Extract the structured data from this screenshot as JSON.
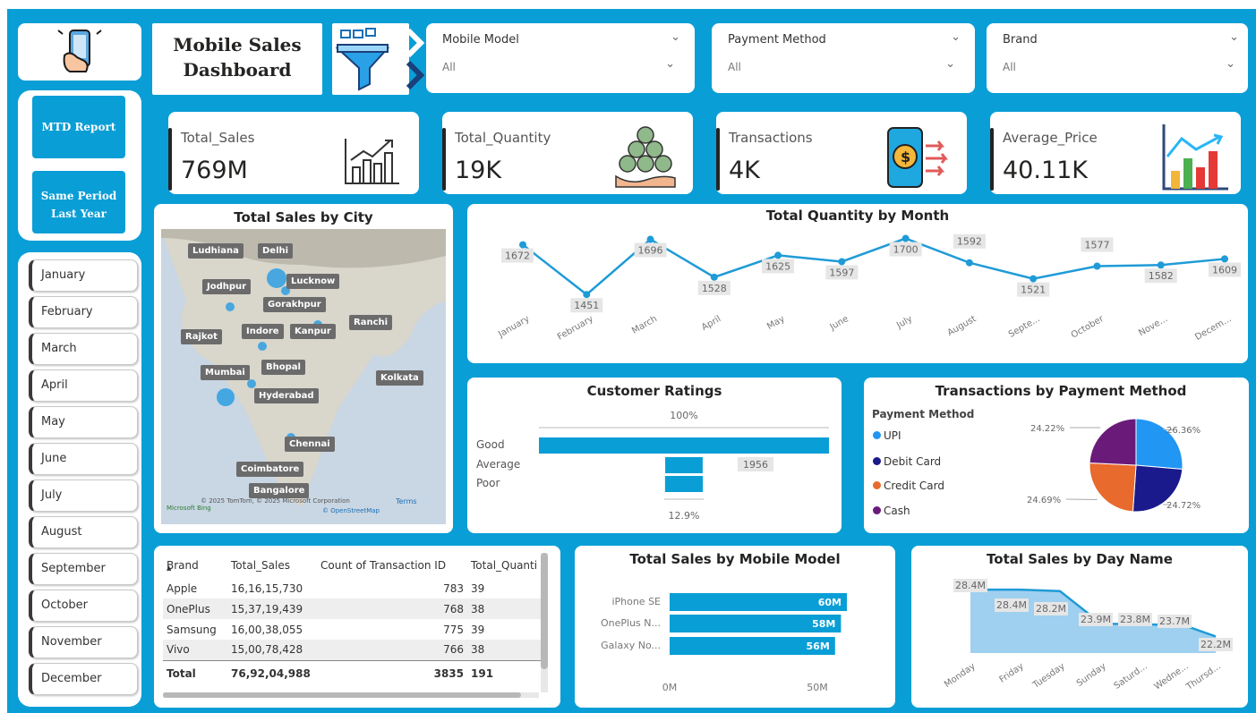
{
  "header": {
    "title_line1": "Mobile Sales",
    "title_line2": "Dashboard"
  },
  "filters": [
    {
      "label": "Mobile Model",
      "value": "All"
    },
    {
      "label": "Payment Method",
      "value": "All"
    },
    {
      "label": "Brand",
      "value": "All"
    }
  ],
  "nav": {
    "mtd_button": "MTD Report",
    "same_period_line1": "Same Period",
    "same_period_line2": "Last Year"
  },
  "months": [
    "January",
    "February",
    "March",
    "April",
    "May",
    "June",
    "July",
    "August",
    "September",
    "October",
    "November",
    "December"
  ],
  "kpis": [
    {
      "label": "Total_Sales",
      "value": "769M",
      "icon": "bar-chart-growth-icon"
    },
    {
      "label": "Total_Quantity",
      "value": "19K",
      "icon": "money-bags-icon"
    },
    {
      "label": "Transactions",
      "value": "4K",
      "icon": "mobile-payment-icon"
    },
    {
      "label": "Average_Price",
      "value": "40.11K",
      "icon": "colored-bar-chart-icon"
    }
  ],
  "map": {
    "title": "Total Sales by City",
    "cities": [
      "Ludhiana",
      "Delhi",
      "Jodhpur",
      "Lucknow",
      "Gorakhpur",
      "Ranchi",
      "Indore",
      "Kanpur",
      "Rajkot",
      "Bhopal",
      "Mumbai",
      "Kolkata",
      "Hyderabad",
      "Chennai",
      "Coimbatore",
      "Bangalore"
    ],
    "copyright": "© 2025 TomTom, © 2025 Microsoft Corporation",
    "terms": "Terms",
    "osm": "© OpenStreetMap",
    "provider": "Microsoft Bing"
  },
  "chart_data": [
    {
      "type": "line",
      "title": "Total Quantity by Month",
      "categories": [
        "January",
        "February",
        "March",
        "April",
        "May",
        "June",
        "July",
        "August",
        "Septe...",
        "October",
        "Nove...",
        "Decem..."
      ],
      "values": [
        1672,
        1451,
        1696,
        1528,
        1625,
        1597,
        1700,
        1592,
        1521,
        1577,
        1582,
        1609
      ],
      "color": "#1f9bd7"
    },
    {
      "type": "bar",
      "title": "Customer Ratings",
      "categories": [
        "Good",
        "Average",
        "Poor"
      ],
      "values": [
        15145,
        1956,
        1976
      ],
      "labels": [
        "100%",
        "1956",
        "12.9%"
      ],
      "color": "#0a9ed6"
    },
    {
      "type": "pie",
      "title": "Transactions by Payment Method",
      "legend_title": "Payment Method",
      "categories": [
        "UPI",
        "Debit Card",
        "Credit Card",
        "Cash"
      ],
      "values": [
        26.36,
        24.72,
        24.69,
        24.22
      ],
      "labels": [
        "26.36%",
        "24.72%",
        "24.69%",
        "24.22%"
      ],
      "colors": [
        "#2196f3",
        "#1a1a8c",
        "#e86a2c",
        "#6a1b7a"
      ]
    },
    {
      "type": "table",
      "columns": [
        "Brand",
        "Total_Sales",
        "Count of Transaction ID",
        "Total_Quanti"
      ],
      "rows": [
        [
          "Apple",
          "16,16,15,730",
          "783",
          "39"
        ],
        [
          "OnePlus",
          "15,37,19,439",
          "768",
          "38"
        ],
        [
          "Samsung",
          "16,00,38,055",
          "775",
          "39"
        ],
        [
          "Vivo",
          "15,00,78,428",
          "766",
          "38"
        ]
      ],
      "total": [
        "Total",
        "76,92,04,988",
        "3835",
        "191"
      ]
    },
    {
      "type": "bar",
      "title": "Total Sales by Mobile Model",
      "categories": [
        "iPhone SE",
        "OnePlus N...",
        "Galaxy No..."
      ],
      "values": [
        60,
        58,
        56
      ],
      "labels": [
        "60M",
        "58M",
        "56M"
      ],
      "xticks": [
        "0M",
        "50M"
      ],
      "xlim": [
        0,
        60
      ],
      "color": "#0a9ed6"
    },
    {
      "type": "area",
      "title": "Total Sales by Day Name",
      "categories": [
        "Monday",
        "Friday",
        "Tuesday",
        "Sunday",
        "Saturd...",
        "Wedne...",
        "Thursd..."
      ],
      "values": [
        28.4,
        28.4,
        28.2,
        23.9,
        23.8,
        23.7,
        22.2
      ],
      "labels": [
        "28.4M",
        "28.4M",
        "28.2M",
        "23.9M",
        "23.8M",
        "23.7M",
        "22.2M"
      ],
      "color": "#1f9bd7"
    }
  ]
}
